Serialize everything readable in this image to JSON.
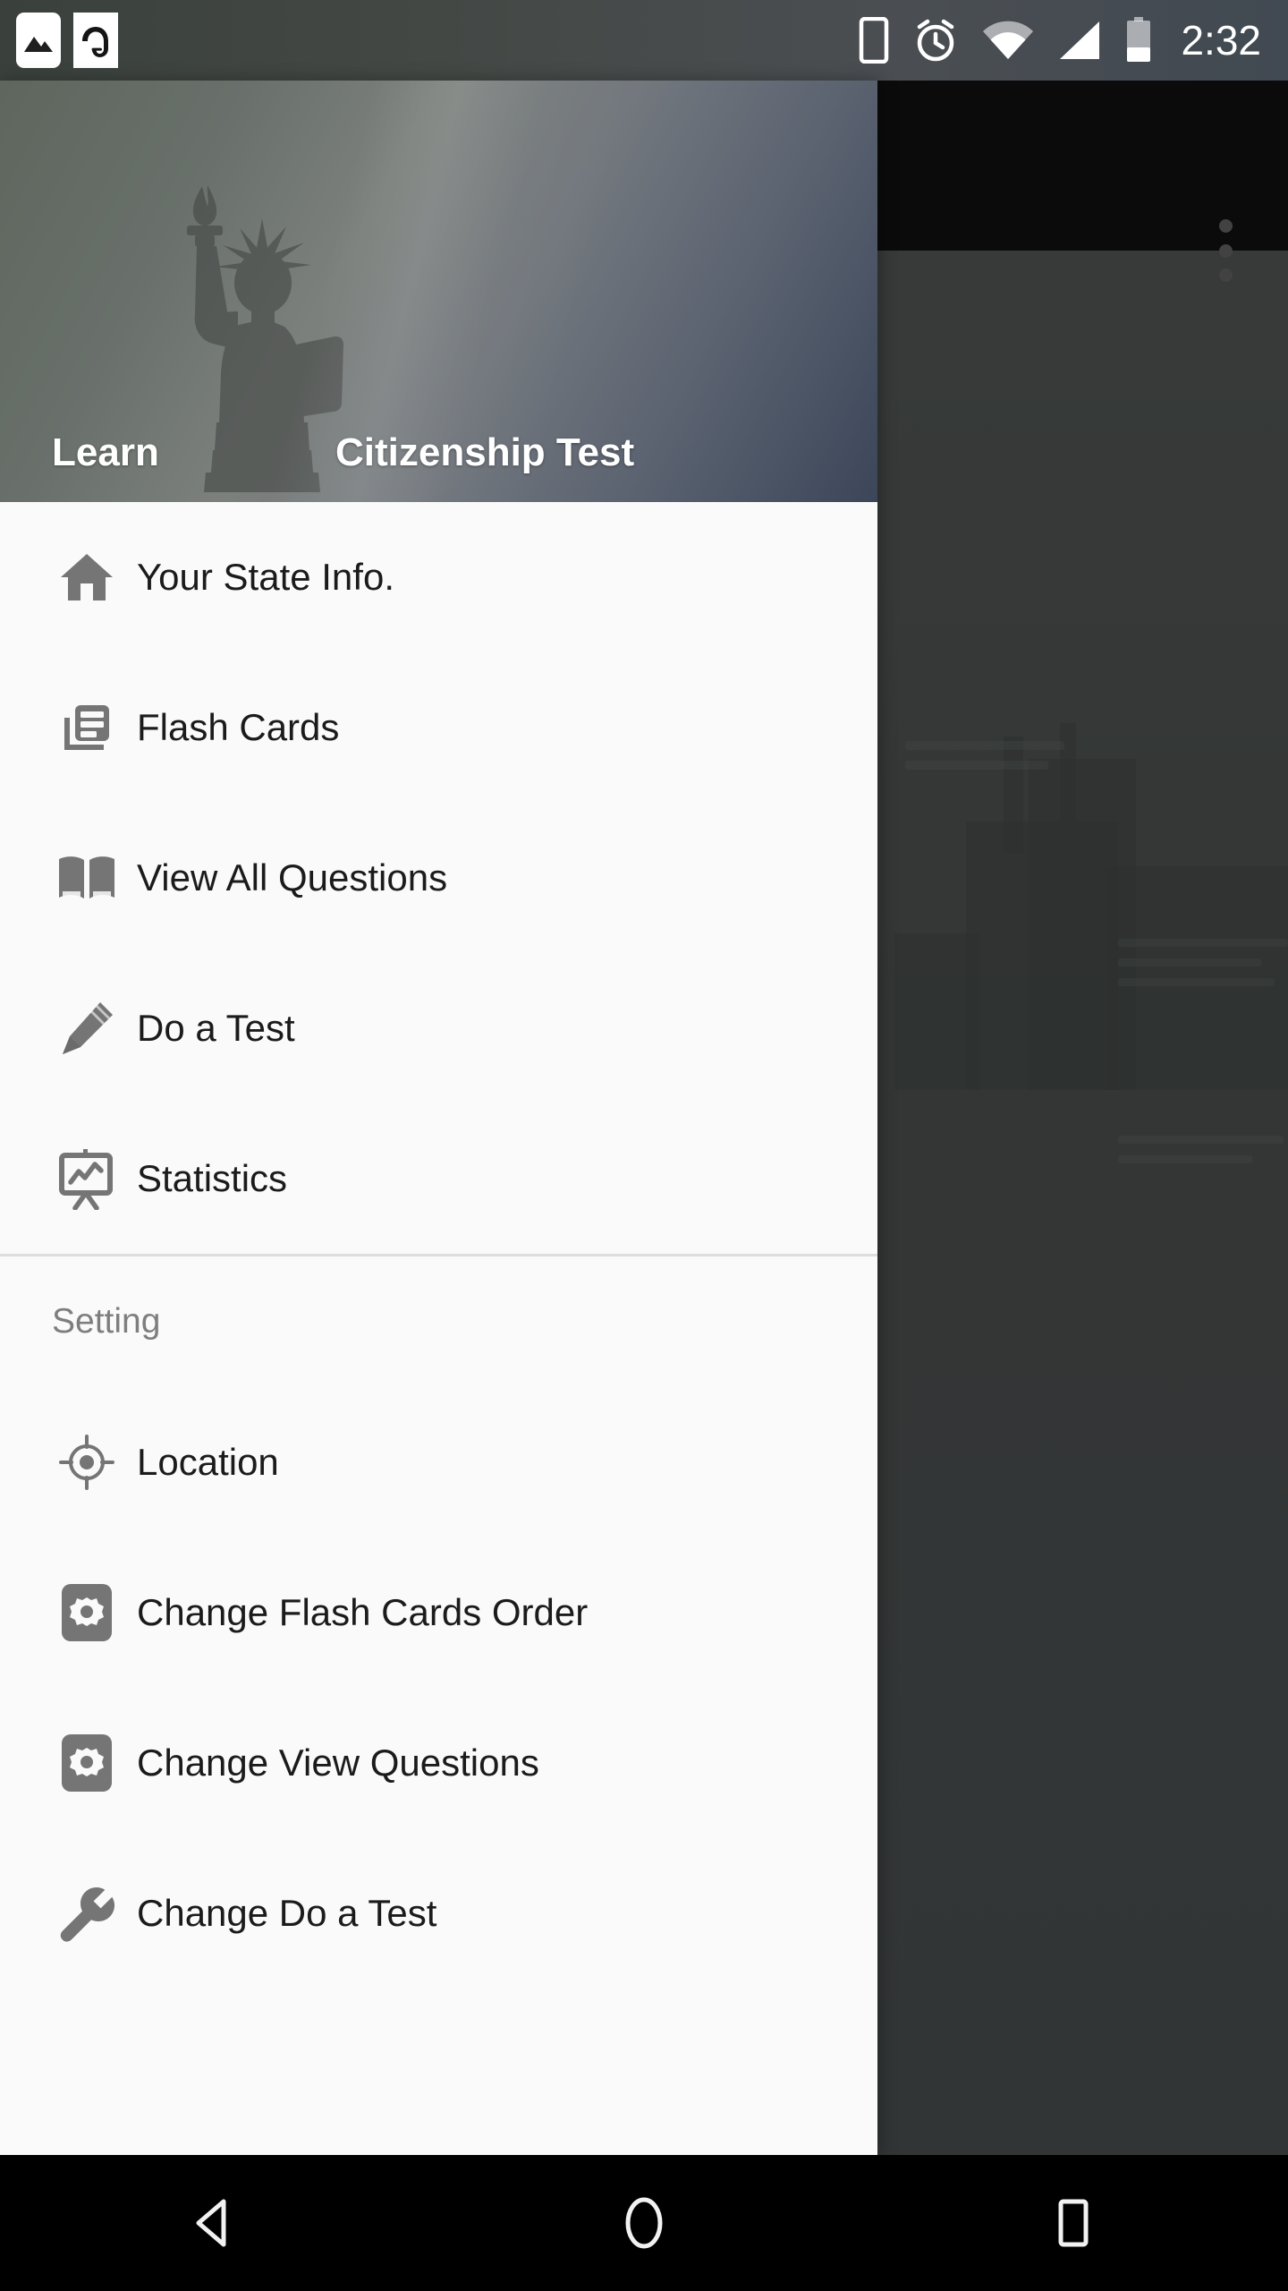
{
  "status_bar": {
    "time": "2:32",
    "notifications": [
      {
        "name": "screenshot-image-icon",
        "glyph": "image"
      },
      {
        "name": "avira-app-icon",
        "glyph": "umbrella"
      }
    ],
    "system_icons": [
      {
        "name": "vibrate-phone-icon"
      },
      {
        "name": "alarm-clock-icon"
      },
      {
        "name": "wifi-icon"
      },
      {
        "name": "cellular-signal-icon"
      },
      {
        "name": "battery-icon"
      }
    ],
    "colors": {
      "background": "#444845",
      "foreground": "#ffffff"
    }
  },
  "app_bar": {
    "overflow_menu_label": "More options",
    "background": "#131313"
  },
  "drawer": {
    "header": {
      "title_left": "Learn",
      "title_right": "Citizenship Test",
      "image_name": "statue-of-liberty-silhouette",
      "background_gradient_from": "#5e665d",
      "background_gradient_to": "#3c4659",
      "text_color": "#ffffff"
    },
    "primary_items": [
      {
        "label": "Your State Info.",
        "icon": "home-icon"
      },
      {
        "label": "Flash Cards",
        "icon": "chrome-reader-mode-icon"
      },
      {
        "label": "View All Questions",
        "icon": "open-book-icon"
      },
      {
        "label": "Do a Test",
        "icon": "pencil-edit-icon"
      },
      {
        "label": "Statistics",
        "icon": "presentation-chart-icon"
      }
    ],
    "settings_section_label": "Setting",
    "settings_items": [
      {
        "label": "Location",
        "icon": "gps-crosshair-icon"
      },
      {
        "label": "Change Flash Cards Order",
        "icon": "settings-gear-icon"
      },
      {
        "label": "Change View Questions",
        "icon": "settings-gear-icon"
      },
      {
        "label": "Change Do a Test",
        "icon": "wrench-icon"
      }
    ],
    "colors": {
      "background": "#fafafa",
      "label_text": "#1b1b1b",
      "section_text": "#7e7e7e",
      "icon": "#757575",
      "divider": "#dddddd"
    }
  },
  "navigation_bar": {
    "buttons": [
      {
        "label": "Back",
        "icon": "back-triangle-icon"
      },
      {
        "label": "Home",
        "icon": "home-circle-icon"
      },
      {
        "label": "Recents",
        "icon": "recents-square-icon"
      }
    ],
    "background": "#000000"
  }
}
